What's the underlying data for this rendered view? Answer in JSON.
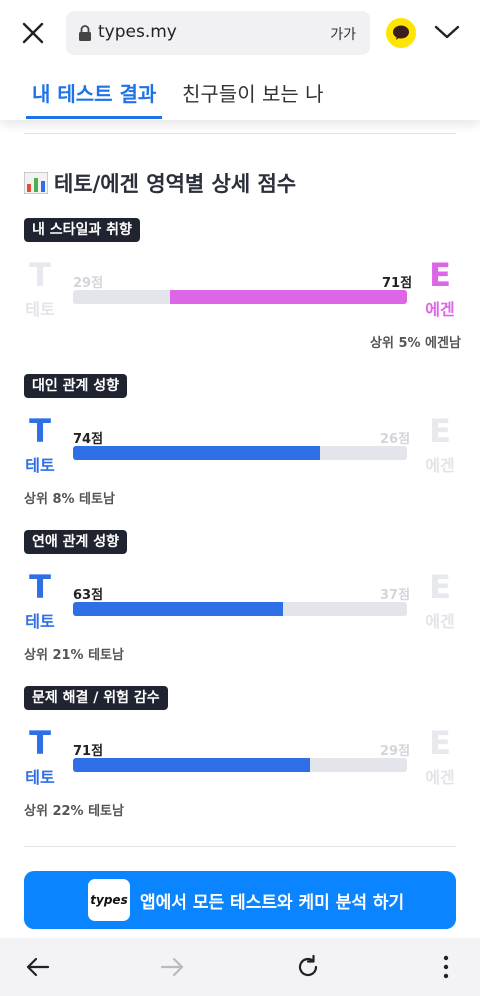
{
  "browser": {
    "url": "types.my",
    "text_size_label": "가가"
  },
  "tabs": [
    {
      "label": "내 테스트 결과",
      "active": true
    },
    {
      "label": "친구들이 보는 나",
      "active": false
    }
  ],
  "section": {
    "title": "테토/에겐 영역별 상세 점수"
  },
  "left_letter": "T",
  "left_name": "테토",
  "right_letter": "E",
  "right_name": "에겐",
  "colors": {
    "teto": "#2f6fe5",
    "egen": "#dd66e6",
    "inactive": "#e4e5ea",
    "brand_blue": "#0a84ff"
  },
  "categories": [
    {
      "label": "내 스타일과 취향",
      "left_score": "29점",
      "right_score": "71점",
      "winner": "right",
      "fill_percent": 71,
      "rank": "상위 5% 에겐남"
    },
    {
      "label": "대인 관계 성향",
      "left_score": "74점",
      "right_score": "26점",
      "winner": "left",
      "fill_percent": 74,
      "rank": "상위 8% 테토남"
    },
    {
      "label": "연애 관계 성향",
      "left_score": "63점",
      "right_score": "37점",
      "winner": "left",
      "fill_percent": 63,
      "rank": "상위 21% 테토남"
    },
    {
      "label": "문제 해결 / 위험 감수",
      "left_score": "71점",
      "right_score": "29점",
      "winner": "left",
      "fill_percent": 71,
      "rank": "상위 22% 테토남"
    }
  ],
  "cta": {
    "logo_text": "types",
    "label": "앱에서 모든 테스트와 케미 분석 하기"
  }
}
